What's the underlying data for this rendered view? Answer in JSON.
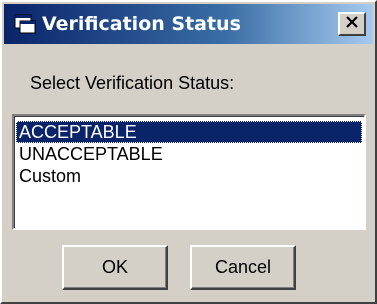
{
  "window": {
    "title": "Verification Status",
    "icon": "app-window-icon",
    "close_label": "×"
  },
  "prompt": "Select Verification Status:",
  "list": {
    "items": [
      {
        "label": "ACCEPTABLE",
        "selected": true
      },
      {
        "label": "UNACCEPTABLE",
        "selected": false
      },
      {
        "label": "Custom",
        "selected": false
      }
    ]
  },
  "buttons": {
    "ok_label": "OK",
    "cancel_label": "Cancel"
  },
  "colors": {
    "selection_bg": "#0a246a",
    "face": "#d4d0c8"
  }
}
